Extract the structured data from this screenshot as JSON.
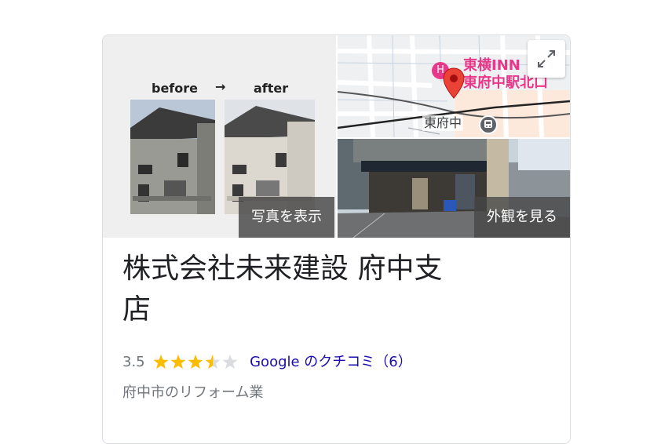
{
  "gallery": {
    "photo_caption_before": "before",
    "photo_caption_arrow": "→",
    "photo_caption_after": "after",
    "photo_button_label": "写真を表示",
    "street_button_label": "外観を見る",
    "map_labels": {
      "hotel_line1": "東横INN",
      "hotel_line2": "東府中駅北口",
      "station": "東府中"
    }
  },
  "business": {
    "name_line1": "株式会社未来建設 府中支",
    "name_line2": "店",
    "rating": "3.5",
    "rating_value": 3.5,
    "rating_max": 5,
    "reviews_label": "Google のクチコミ（6）",
    "category": "府中市のリフォーム業"
  },
  "colors": {
    "star_fill": "#fbbc04",
    "star_empty": "#dadce0",
    "link": "#1a0dab",
    "muted": "#70757a",
    "pin": "#ea4335",
    "hotel_pink": "#e8388a"
  }
}
